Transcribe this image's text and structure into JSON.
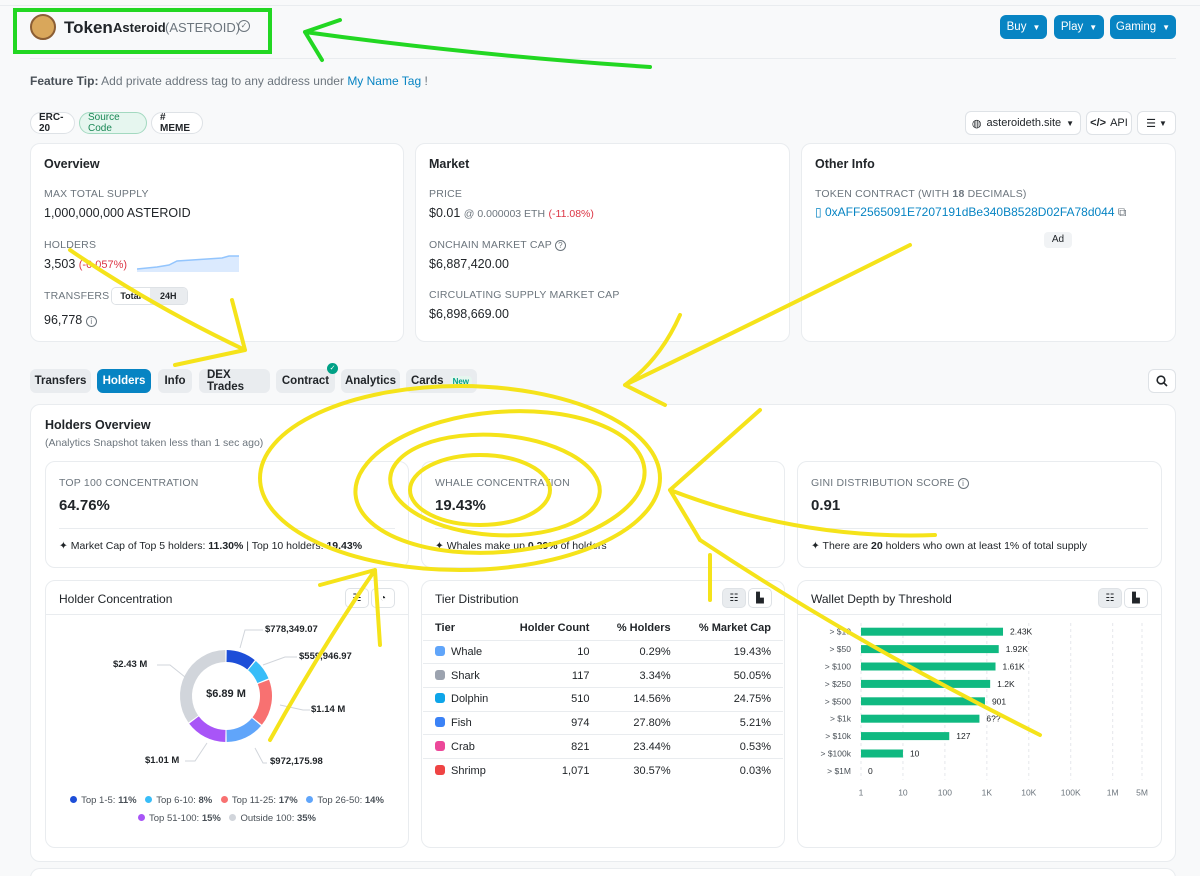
{
  "header": {
    "title": "Token",
    "token_name": "Asteroid",
    "token_symbol": "(ASTEROID)",
    "buttons": [
      "Buy",
      "Play",
      "Gaming"
    ]
  },
  "feature_tip": {
    "label": "Feature Tip:",
    "text": "Add private address tag to any address under",
    "link": "My Name Tag",
    "suffix": "!"
  },
  "tags": [
    "ERC-20",
    "Source Code",
    "# MEME"
  ],
  "right_tools": {
    "site": "asteroideth.site",
    "api": "API"
  },
  "overview": {
    "title": "Overview",
    "max_supply_label": "MAX TOTAL SUPPLY",
    "max_supply": "1,000,000,000 ASTEROID",
    "holders_label": "HOLDERS",
    "holders": "3,503",
    "holders_change": "(-0.057%)",
    "transfers_label": "TRANSFERS",
    "transfers_toggle": [
      "Total",
      "24H"
    ],
    "transfers": "96,778"
  },
  "market": {
    "title": "Market",
    "price_label": "PRICE",
    "price": "$0.01",
    "price_eth": "@ 0.000003 ETH",
    "price_change": "(-11.08%)",
    "onchain_cap_label": "ONCHAIN MARKET CAP",
    "onchain_cap": "$6,887,420.00",
    "circ_cap_label": "CIRCULATING SUPPLY MARKET CAP",
    "circ_cap": "$6,898,669.00"
  },
  "other": {
    "title": "Other Info",
    "contract_label_pre": "TOKEN CONTRACT (WITH",
    "decimals": "18",
    "contract_label_post": "DECIMALS)",
    "contract": "0xAFF2565091E7207191dBe340B8528D02FA78d044",
    "ad": "Ad"
  },
  "tabs": [
    "Transfers",
    "Holders",
    "Info",
    "DEX Trades",
    "Contract",
    "Analytics",
    "Cards",
    "New"
  ],
  "holders_overview": {
    "title": "Holders Overview",
    "subtitle": "(Analytics Snapshot taken less than 1 sec ago)",
    "top100_label": "TOP 100 CONCENTRATION",
    "top100": "64.76%",
    "top100_note_pre": "Market Cap of Top 5 holders:",
    "top100_note_v1": "11.30%",
    "top100_note_mid": "| Top 10 holders:",
    "top100_note_v2": "19.43%",
    "whale_label": "WHALE CONCENTRATION",
    "whale": "19.43%",
    "whale_note_pre": "Whales make up",
    "whale_note_v": "0.29%",
    "whale_note_post": "of holders",
    "gini_label": "GINI DISTRIBUTION SCORE",
    "gini": "0.91",
    "gini_note_pre": "There are",
    "gini_note_v": "20",
    "gini_note_post": "holders who own at least 1% of total supply"
  },
  "holder_concentration": {
    "title": "Holder Concentration",
    "center": "$6.89 M",
    "labels": [
      "$778,349.07",
      "$559,946.97",
      "$1.14 M",
      "$972,175.98",
      "$1.01 M",
      "$2.43 M"
    ],
    "segments": [
      {
        "name": "Top 1-5",
        "pct": 11,
        "color": "#1d4ed8"
      },
      {
        "name": "Top 6-10",
        "pct": 8,
        "color": "#38bdf8"
      },
      {
        "name": "Top 11-25",
        "pct": 17,
        "color": "#f87171"
      },
      {
        "name": "Top 26-50",
        "pct": 14,
        "color": "#60a5fa"
      },
      {
        "name": "Top 51-100",
        "pct": 15,
        "color": "#a855f7"
      },
      {
        "name": "Outside 100",
        "pct": 35,
        "color": "#d1d5db"
      }
    ],
    "legend": [
      {
        "name": "Top 1-5:",
        "pct": "11%"
      },
      {
        "name": "Top 6-10:",
        "pct": "8%"
      },
      {
        "name": "Top 11-25:",
        "pct": "17%"
      },
      {
        "name": "Top 26-50:",
        "pct": "14%"
      },
      {
        "name": "Top 51-100:",
        "pct": "15%"
      },
      {
        "name": "Outside 100:",
        "pct": "35%"
      }
    ]
  },
  "tier_distribution": {
    "title": "Tier Distribution",
    "headers": [
      "Tier",
      "Holder Count",
      "% Holders",
      "% Market Cap"
    ],
    "rows": [
      {
        "tier": "Whale",
        "count": "10",
        "holders": "0.29%",
        "cap": "19.43%",
        "color": "#60a5fa"
      },
      {
        "tier": "Shark",
        "count": "117",
        "holders": "3.34%",
        "cap": "50.05%",
        "color": "#9ca3af"
      },
      {
        "tier": "Dolphin",
        "count": "510",
        "holders": "14.56%",
        "cap": "24.75%",
        "color": "#0ea5e9"
      },
      {
        "tier": "Fish",
        "count": "974",
        "holders": "27.80%",
        "cap": "5.21%",
        "color": "#3b82f6"
      },
      {
        "tier": "Crab",
        "count": "821",
        "holders": "23.44%",
        "cap": "0.53%",
        "color": "#ec4899"
      },
      {
        "tier": "Shrimp",
        "count": "1,071",
        "holders": "30.57%",
        "cap": "0.03%",
        "color": "#ef4444"
      }
    ]
  },
  "wallet_depth": {
    "title": "Wallet Depth by Threshold"
  },
  "chart_data": {
    "type": "bar",
    "title": "Wallet Depth by Threshold",
    "orientation": "horizontal",
    "x_scale": "log",
    "categories": [
      "> $10",
      "> $50",
      "> $100",
      "> $250",
      "> $500",
      "> $1k",
      "> $10k",
      "> $100k",
      "> $1M"
    ],
    "values": [
      2430,
      1920,
      1610,
      1200,
      901,
      666,
      127,
      10,
      0
    ],
    "value_labels": [
      "2.43K",
      "1.92K",
      "1.61K",
      "1.2K",
      "901",
      "6??",
      "127",
      "10",
      "0"
    ],
    "x_ticks": [
      "1",
      "10",
      "100",
      "1K",
      "10K",
      "100K",
      "1M",
      "5M"
    ],
    "xlim": [
      1,
      5000000
    ],
    "color": "#10b981",
    "grid": true
  }
}
